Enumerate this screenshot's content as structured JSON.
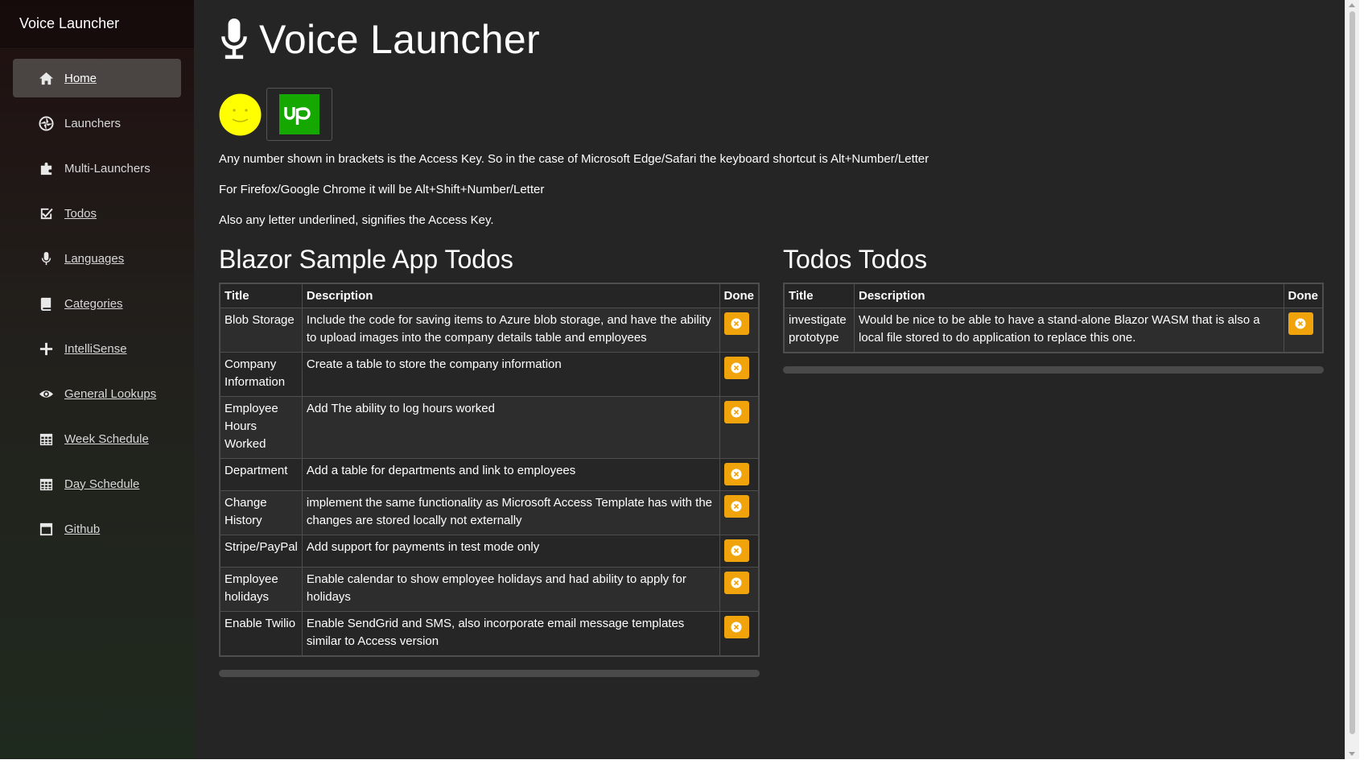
{
  "sidebar": {
    "brand": "Voice Launcher",
    "items": [
      {
        "label": "Home",
        "icon": "home-icon",
        "active": true
      },
      {
        "label": "Launchers",
        "icon": "aperture-icon",
        "active": false
      },
      {
        "label": "Multi-Launchers",
        "icon": "puzzle-icon",
        "active": false
      },
      {
        "label": "Todos",
        "icon": "checkbox-icon",
        "active": false
      },
      {
        "label": "Languages",
        "icon": "microphone-icon",
        "active": false
      },
      {
        "label": "Categories",
        "icon": "book-icon",
        "active": false
      },
      {
        "label": "IntelliSense",
        "icon": "plus-icon",
        "active": false
      },
      {
        "label": "General Lookups",
        "icon": "eye-icon",
        "active": false
      },
      {
        "label": "Week Schedule",
        "icon": "calendar-grid-icon",
        "active": false
      },
      {
        "label": "Day Schedule",
        "icon": "calendar-grid-icon",
        "active": false
      },
      {
        "label": "Github",
        "icon": "browser-window-icon",
        "active": false
      }
    ]
  },
  "main": {
    "title": "Voice Launcher",
    "title_icon": "microphone-icon",
    "logos": [
      "smiley-icon",
      "upwork-logo"
    ],
    "info": [
      "Any number shown in brackets is the Access Key. So in the case of Microsoft Edge/Safari the keyboard shortcut is Alt+Number/Letter",
      "For Firefox/Google Chrome it will be Alt+Shift+Number/Letter",
      "Also any letter underlined, signifies the Access Key."
    ]
  },
  "blazor_todos": {
    "heading": "Blazor Sample App Todos",
    "columns": [
      "Title",
      "Description",
      "Done"
    ],
    "rows": [
      {
        "title": "Blob Storage",
        "description": "Include the code for saving items to Azure blob storage, and have the ability to upload images into the company details table and employees"
      },
      {
        "title": "Company Information",
        "description": "Create a table to store the company information"
      },
      {
        "title": "Employee Hours Worked",
        "description": "Add The ability to log hours worked"
      },
      {
        "title": "Department",
        "description": "Add a table for departments and link to employees"
      },
      {
        "title": "Change History",
        "description": "implement the same functionality as Microsoft Access Template has with the changes are stored locally not externally"
      },
      {
        "title": "Stripe/PayPal",
        "description": "Add support for payments in test mode only"
      },
      {
        "title": "Employee holidays",
        "description": "Enable calendar to show employee holidays and had ability to apply for holidays"
      },
      {
        "title": "Enable Twilio",
        "description": "Enable SendGrid and SMS, also incorporate email message templates similar to Access version"
      }
    ]
  },
  "todos_todos": {
    "heading": "Todos Todos",
    "columns": [
      "Title",
      "Description",
      "Done"
    ],
    "rows": [
      {
        "title": "investigate prototype",
        "description": "Would be nice to be able to have a stand-alone Blazor WASM that is also a local file stored to do application to replace this one."
      }
    ]
  },
  "colors": {
    "background": "#252525",
    "active_nav": "#4a4443",
    "done_button": "#f0a30a",
    "upwork_green": "#14a800",
    "smiley_yellow": "#ffff00"
  }
}
